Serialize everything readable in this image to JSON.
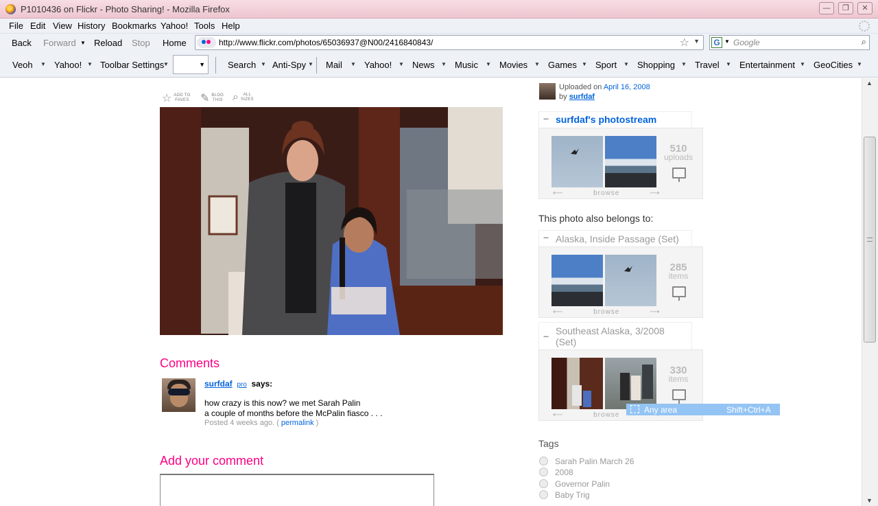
{
  "window": {
    "title": "P1010436 on Flickr - Photo Sharing! - Mozilla Firefox",
    "minimize": "—",
    "maximize": "❐",
    "close": "✕"
  },
  "menu": [
    "File",
    "Edit",
    "View",
    "History",
    "Bookmarks",
    "Yahoo!",
    "Tools",
    "Help"
  ],
  "nav": {
    "back": "Back",
    "forward": "Forward",
    "reload": "Reload",
    "stop": "Stop",
    "home": "Home",
    "url": "http://www.flickr.com/photos/65036937@N00/2416840843/",
    "search_placeholder": "Google",
    "search_engine": "G"
  },
  "yahoo_toolbar": [
    "Veoh",
    "Yahoo!",
    "Toolbar Settings",
    "Search",
    "Anti-Spy",
    "Mail",
    "Yahoo!",
    "News",
    "Music",
    "Movies",
    "Games",
    "Sport",
    "Shopping",
    "Travel",
    "Entertainment",
    "GeoCities"
  ],
  "photo_tools": [
    {
      "line1": "ADD TO",
      "line2": "FAVES",
      "icon": "star-icon"
    },
    {
      "line1": "BLOG",
      "line2": "THIS",
      "icon": "blog-icon"
    },
    {
      "line1": "ALL",
      "line2": "SIZES",
      "icon": "magnifier-icon"
    }
  ],
  "comments": {
    "heading": "Comments",
    "author": "surfdaf",
    "pro": "pro",
    "says": "says:",
    "line1": "how crazy is this now? we met Sarah Palin",
    "line2": "a couple of months before the McPalin fiasco . . .",
    "posted": "Posted 4 weeks ago. (",
    "permalink": "permalink",
    "close_paren": ")"
  },
  "add_comment": {
    "heading": "Add your comment"
  },
  "uploader": {
    "uploaded_on": "Uploaded on",
    "date": "April 16, 2008",
    "by": "by",
    "name": "surfdaf"
  },
  "photostream": {
    "title": "surfdaf's photostream",
    "count": "510",
    "unit": "uploads",
    "browse": "browse"
  },
  "belongs_to": "This photo also belongs to:",
  "sets": [
    {
      "title": "Alaska, Inside Passage (Set)",
      "count": "285",
      "unit": "items",
      "browse": "browse"
    },
    {
      "title": "Southeast Alaska, 3/2008 (Set)",
      "count": "330",
      "unit": "items",
      "browse": "browse"
    }
  ],
  "tags": {
    "heading": "Tags",
    "items": [
      "Sarah Palin March 26",
      "2008",
      "Governor Palin",
      "Baby Trig"
    ]
  },
  "overlay": {
    "label": "Any area",
    "shortcut": "Shift+Ctrl+A"
  }
}
